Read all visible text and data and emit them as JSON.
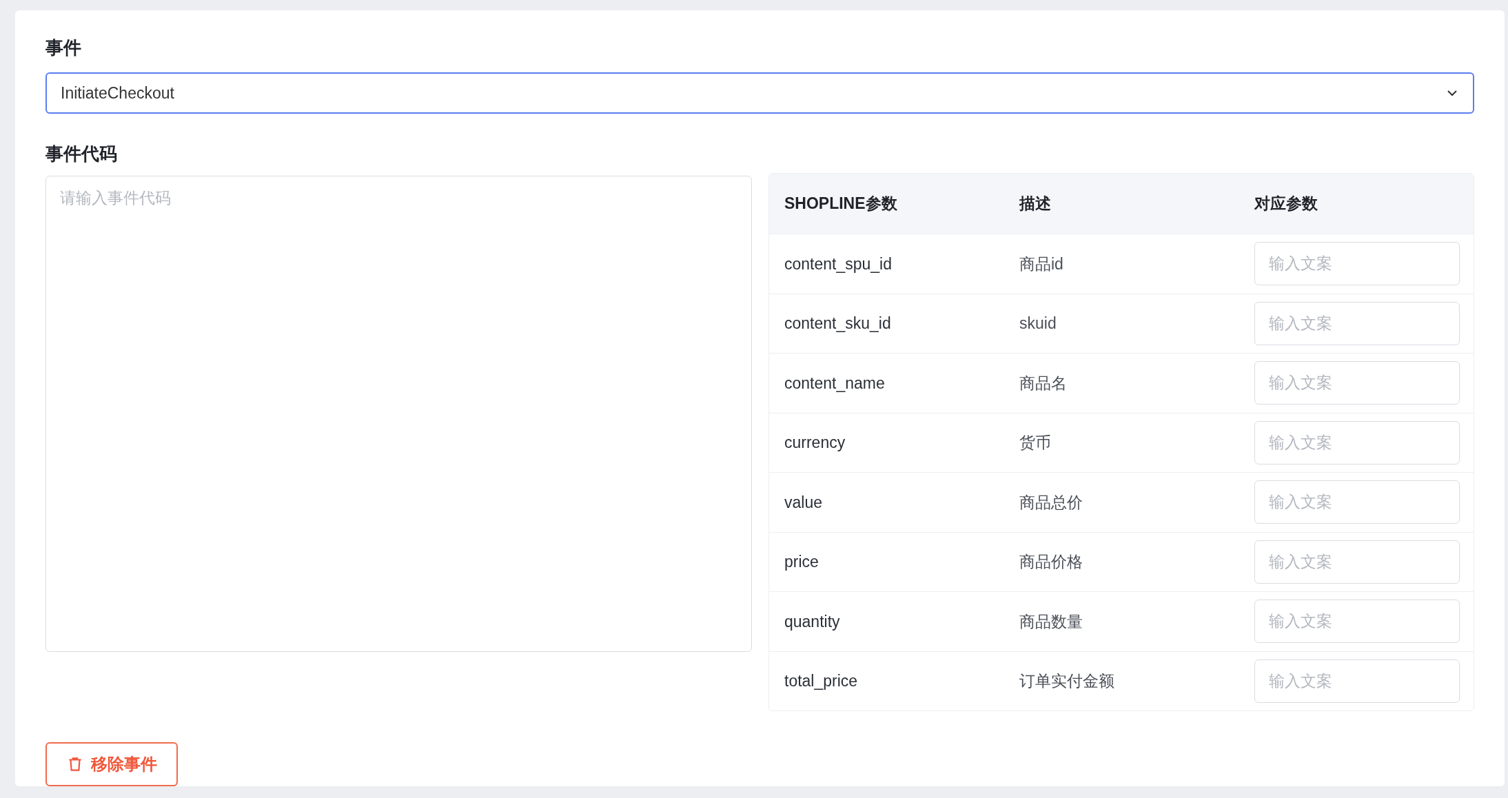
{
  "event": {
    "label": "事件",
    "value": "InitiateCheckout"
  },
  "event_code": {
    "label": "事件代码",
    "placeholder": "请输入事件代码"
  },
  "table": {
    "columns": [
      "SHOPLINE参数",
      "描述",
      "对应参数"
    ],
    "rows": [
      {
        "param": "content_spu_id",
        "description": "商品id",
        "placeholder": "输入文案"
      },
      {
        "param": "content_sku_id",
        "description": "skuid",
        "placeholder": "输入文案"
      },
      {
        "param": "content_name",
        "description": "商品名",
        "placeholder": "输入文案"
      },
      {
        "param": "currency",
        "description": "货币",
        "placeholder": "输入文案"
      },
      {
        "param": "value",
        "description": "商品总价",
        "placeholder": "输入文案"
      },
      {
        "param": "price",
        "description": "商品价格",
        "placeholder": "输入文案"
      },
      {
        "param": "quantity",
        "description": "商品数量",
        "placeholder": "输入文案"
      },
      {
        "param": "total_price",
        "description": "订单实付金额",
        "placeholder": "输入文案"
      }
    ]
  },
  "remove_button": "移除事件"
}
